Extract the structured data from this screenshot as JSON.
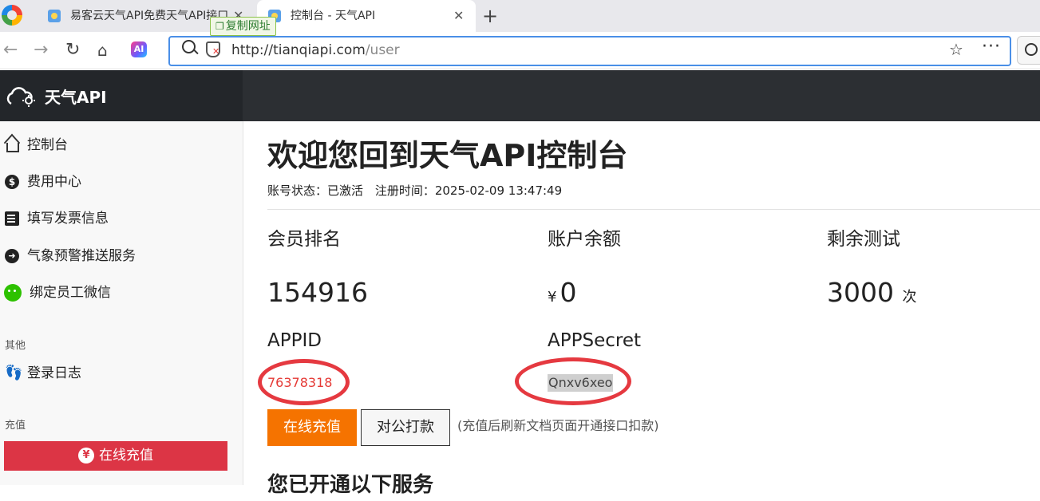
{
  "browser": {
    "tabs": [
      {
        "title": "易客云天气API免费天气API接口",
        "active": false
      },
      {
        "title": "控制台 - 天气API",
        "active": true
      }
    ],
    "new_tab_label": "+",
    "copy_tooltip": "复制网址",
    "url_host": "http://tianqiapi.com",
    "url_path": "/user",
    "ai_label": "AI"
  },
  "app": {
    "brand": "天气API"
  },
  "sidebar": {
    "items": [
      {
        "label": "控制台",
        "icon": "home-icon"
      },
      {
        "label": "费用中心",
        "icon": "dollar-icon"
      },
      {
        "label": "填写发票信息",
        "icon": "invoice-icon"
      },
      {
        "label": "气象预警推送服务",
        "icon": "push-icon"
      },
      {
        "label": "绑定员工微信",
        "icon": "wechat-icon"
      }
    ],
    "group_other": "其他",
    "login_log": "登录日志",
    "group_recharge": "充值",
    "recharge_button": "在线充值",
    "recharge_icon_glyph": "¥"
  },
  "main": {
    "title": "欢迎您回到天气API控制台",
    "account_status_label": "账号状态：",
    "account_status": "已激活",
    "register_time_label": "注册时间：",
    "register_time": "2025-02-09 13:47:49",
    "stats": {
      "rank_label": "会员排名",
      "rank_value": "154916",
      "balance_label": "账户余额",
      "currency": "¥",
      "balance_value": "0",
      "trial_label": "剩余测试",
      "trial_value": "3000",
      "trial_unit": "次"
    },
    "appid_label": "APPID",
    "appid_value": "76378318",
    "appsecret_label": "APPSecret",
    "appsecret_value": "Qnxv6xeo",
    "recharge_button": "在线充值",
    "transfer_button": "对公打款",
    "note": "(充值后刷新文档页面开通接口扣款)",
    "services_heading": "您已开通以下服务"
  },
  "colors": {
    "header_dark": "#2c2f33",
    "danger_red": "#dc3545",
    "orange": "#f57300",
    "annotation_red": "#e53940",
    "address_border": "#4a8fe7"
  }
}
